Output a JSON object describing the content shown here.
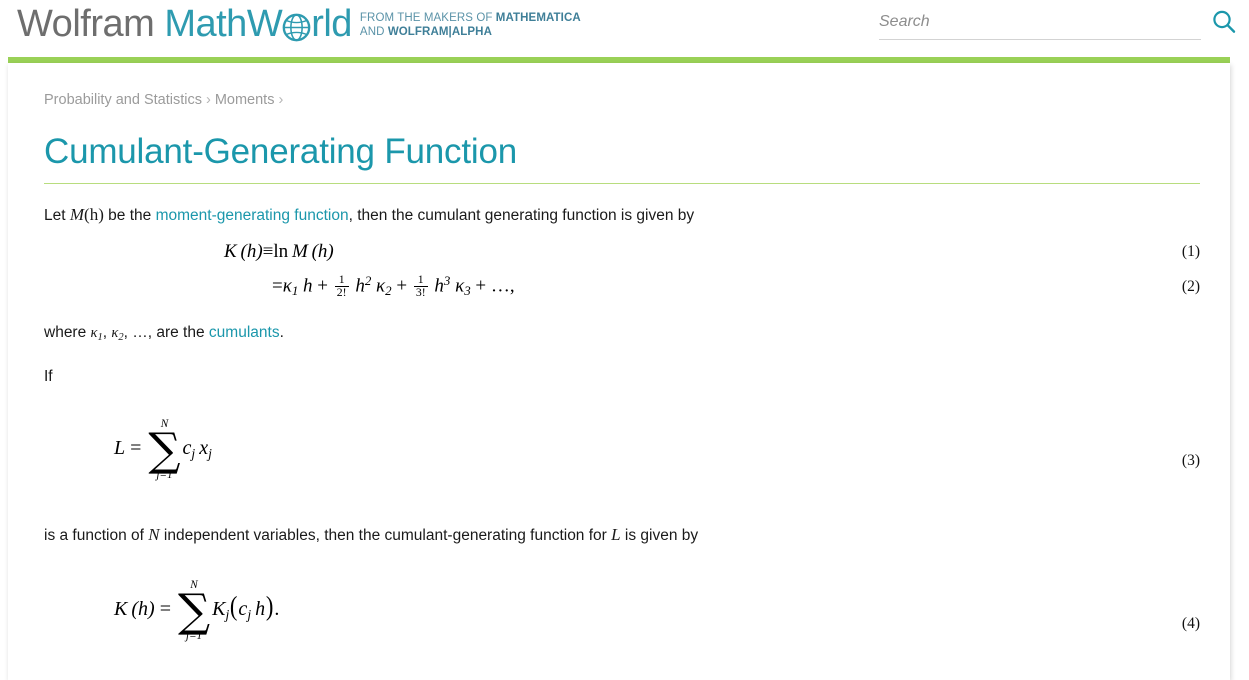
{
  "header": {
    "logo": {
      "word_wolfram": "Wolfram",
      "word_math": "Math",
      "word_w": "W",
      "word_rld": "rld",
      "globe_icon": "globe-icon",
      "tagline_line1_plain": "FROM THE MAKERS OF ",
      "tagline_line1_bold": "MATHEMATICA",
      "tagline_line2_plain": "AND ",
      "tagline_line2_bold": "WOLFRAM|ALPHA"
    },
    "search": {
      "placeholder": "Search",
      "value": "",
      "icon": "search-icon"
    },
    "accent_green": "#9ad157",
    "accent_teal": "#1b97ab"
  },
  "breadcrumb": {
    "items": [
      {
        "label": "Probability and Statistics"
      },
      {
        "label": "Moments"
      }
    ],
    "separator": "›"
  },
  "page": {
    "title": "Cumulant-Generating Function"
  },
  "content": {
    "para1": {
      "p1": "Let ",
      "m1": "M",
      "m2": "(h)",
      "p2": " be the ",
      "link": "moment-generating function",
      "p3": ", then the cumulant generating function is given by"
    },
    "equation1": {
      "number": "(1)",
      "lhs_K": "K",
      "lhs_h": "(h)",
      "equiv": "≡",
      "ln": "ln",
      "rhs_M": "M",
      "rhs_h": "(h)",
      "plain": "K (h) ≡ ln M (h)"
    },
    "equation2": {
      "number": "(2)",
      "eq": "=",
      "kappa": "κ",
      "s1": "1",
      "h": "h",
      "plus": "+",
      "frac1_num": "1",
      "frac1_den": "2!",
      "h2_sup": "2",
      "s2": "2",
      "frac2_num": "1",
      "frac2_den": "3!",
      "h3_sup": "3",
      "s3": "3",
      "tail": "+ …,",
      "plain": "= κ₁ h + 1/2! h² κ₂ + 1/3! h³ κ₃ + …,"
    },
    "para2": {
      "p1": "where ",
      "k1": "κ",
      "k1s": "1",
      "c1": ", ",
      "k2": "κ",
      "k2s": "2",
      "c2": ", …, are the ",
      "link": "cumulants",
      "p3": "."
    },
    "para3": {
      "text": "If"
    },
    "equation3": {
      "number": "(3)",
      "L": "L",
      "eq": "=",
      "sum_top": "N",
      "sum_glyph": "∑",
      "sum_bottom": "j=1",
      "c": "c",
      "c_sub": "j",
      "x": "x",
      "x_sub": "j",
      "plain": "L = ∑(j=1..N) c_j x_j"
    },
    "para4": {
      "p1": "is a function of ",
      "N": "N",
      "p2": " independent variables, then the cumulant-generating function for ",
      "L": "L",
      "p3": " is given by"
    },
    "equation4": {
      "number": "(4)",
      "K": "K",
      "Kh": "(h)",
      "eq": "=",
      "sum_top": "N",
      "sum_glyph": "∑",
      "sum_bottom": "j=1",
      "Kj": "K",
      "Kj_sub": "j",
      "open": "(",
      "c": "c",
      "c_sub": "j",
      "h": "h",
      "close": ")",
      "period": ".",
      "plain": "K (h) = ∑(j=1..N) K_j (c_j h)."
    }
  }
}
